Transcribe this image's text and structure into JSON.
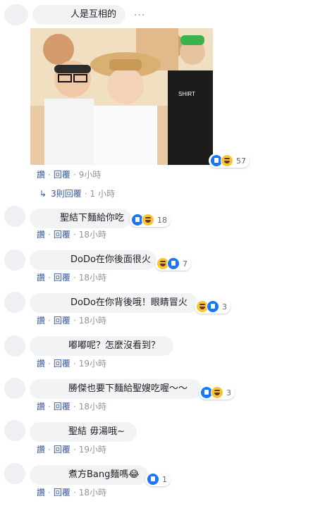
{
  "colors": {
    "link": "#385898",
    "meta": "#90949c",
    "bubble": "#f2f3f5",
    "like": "#1877f2",
    "haha": "#f7c630"
  },
  "more_icon": "...",
  "actions": {
    "like": "讚",
    "reply": "回覆"
  },
  "comments": [
    {
      "text": "人是互相的",
      "time": "9小時",
      "reactions": [
        "like",
        "haha"
      ],
      "count": "57"
    },
    {
      "text": "聖結下麵給你吃",
      "time": "18小時",
      "reactions": [
        "like",
        "haha"
      ],
      "count": "18"
    },
    {
      "text": "DoDo在你後面很火",
      "time": "18小時",
      "reactions": [
        "haha",
        "like"
      ],
      "count": "7"
    },
    {
      "text": "DoDo在你背後哦！眼睛冒火",
      "time": "18小時",
      "reactions": [
        "haha",
        "like"
      ],
      "count": "3"
    },
    {
      "text": "嘟嘟呢？怎麼沒看到？",
      "time": "19小時",
      "reactions": [],
      "count": ""
    },
    {
      "text": "勝傑也要下麵給聖嫂吃喔～～",
      "time": "18小時",
      "reactions": [
        "like",
        "haha"
      ],
      "count": "3"
    },
    {
      "text": "聖結 毋湯哦~",
      "time": "19小時",
      "reactions": [],
      "count": ""
    },
    {
      "text": "煮方Bang麵嗎😂",
      "time": "18小時",
      "reactions": [
        "like"
      ],
      "count": "1"
    }
  ],
  "replies_link": {
    "label": "3則回覆",
    "time": "1 小時"
  }
}
